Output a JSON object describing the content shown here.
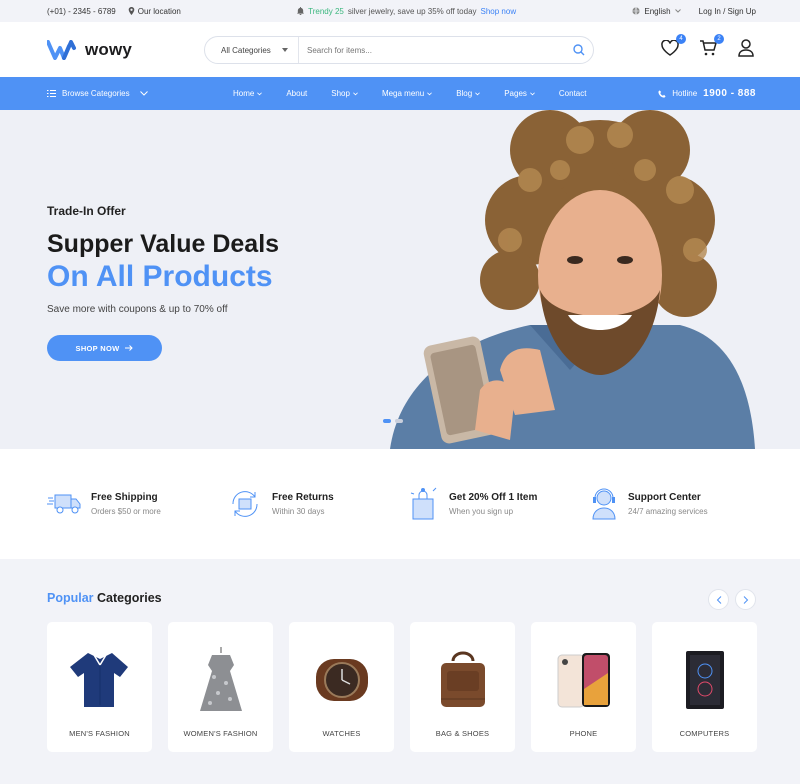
{
  "topbar": {
    "phone": "(+01) - 2345 - 6789",
    "location": "Our location",
    "promo_highlight": "Trendy 25",
    "promo_text": "silver jewelry, save up 35% off today",
    "promo_link": "Shop now",
    "language": "English",
    "auth": "Log In / Sign Up"
  },
  "header": {
    "brand": "wowy",
    "category_select": "All Categories",
    "search_placeholder": "Search for items...",
    "wishlist_count": "4",
    "cart_count": "2"
  },
  "nav": {
    "browse": "Browse Categories",
    "items": [
      {
        "label": "Home",
        "dropdown": true
      },
      {
        "label": "About",
        "dropdown": false
      },
      {
        "label": "Shop",
        "dropdown": true
      },
      {
        "label": "Mega menu",
        "dropdown": true
      },
      {
        "label": "Blog",
        "dropdown": true
      },
      {
        "label": "Pages",
        "dropdown": true
      },
      {
        "label": "Contact",
        "dropdown": false
      }
    ],
    "hotline_label": "Hotline",
    "hotline_number": "1900 - 888"
  },
  "hero": {
    "kicker": "Trade-In Offer",
    "title_line1": "Supper Value Deals",
    "title_line2": "On All Products",
    "subtitle": "Save more with coupons & up to 70% off",
    "cta": "SHOP NOW",
    "slides_total": 2,
    "active_slide": 1
  },
  "features": [
    {
      "title": "Free Shipping",
      "sub": "Orders $50 or more",
      "icon": "truck-icon"
    },
    {
      "title": "Free Returns",
      "sub": "Within 30 days",
      "icon": "return-box-icon"
    },
    {
      "title": "Get 20% Off 1 Item",
      "sub": "When you sign up",
      "icon": "gift-bag-icon"
    },
    {
      "title": "Support Center",
      "sub": "24/7 amazing services",
      "icon": "support-agent-icon"
    }
  ],
  "popular": {
    "title_accent": "Popular",
    "title_rest": "Categories",
    "categories": [
      {
        "label": "MEN'S FASHION",
        "icon": "shirt-icon"
      },
      {
        "label": "WOMEN'S FASHION",
        "icon": "dress-icon"
      },
      {
        "label": "WATCHES",
        "icon": "watch-icon"
      },
      {
        "label": "BAG & SHOES",
        "icon": "bag-icon"
      },
      {
        "label": "PHONE",
        "icon": "phone-icon"
      },
      {
        "label": "COMPUTERS",
        "icon": "computer-case-icon"
      }
    ]
  },
  "colors": {
    "accent": "#4f92f5",
    "green": "#3bb77e",
    "hero_bg": "#eef0f6"
  }
}
